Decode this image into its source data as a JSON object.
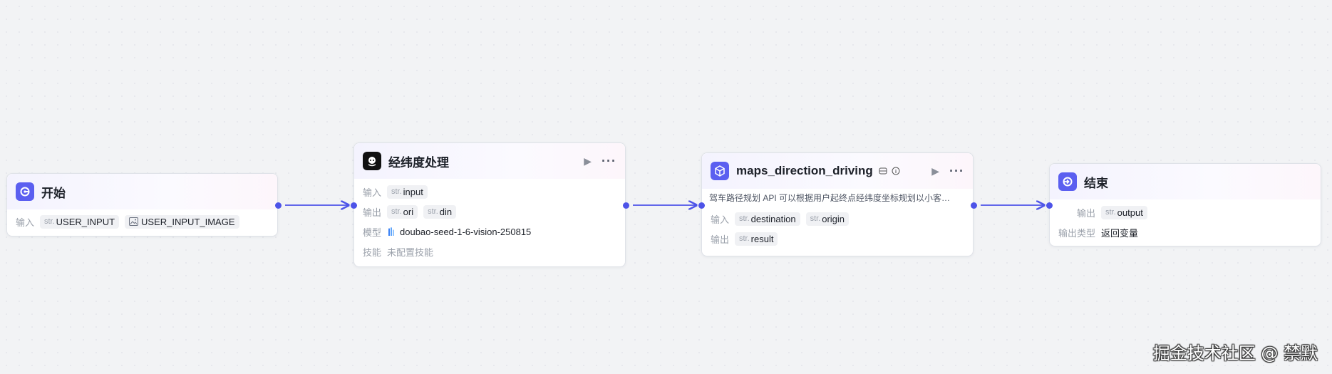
{
  "canvas": {
    "colors": {
      "accent": "#4d53e8",
      "background": "#f2f3f5"
    }
  },
  "nodes": {
    "start": {
      "title": "开始",
      "icon": "start-node-icon",
      "input_label": "输入",
      "inputs": [
        {
          "type": "str.",
          "name": "USER_INPUT"
        },
        {
          "type": "image-icon",
          "name": "USER_INPUT_IMAGE"
        }
      ]
    },
    "llm": {
      "title": "经纬度处理",
      "icon": "llm-node-icon",
      "input_label": "输入",
      "inputs": [
        {
          "type": "str.",
          "name": "input"
        }
      ],
      "output_label": "输出",
      "outputs": [
        {
          "type": "str.",
          "name": "ori"
        },
        {
          "type": "str.",
          "name": "din"
        }
      ],
      "model_label": "模型",
      "model": "doubao-seed-1-6-vision-250815",
      "skill_label": "技能",
      "skill": "未配置技能"
    },
    "plugin": {
      "title": "maps_direction_driving",
      "icon": "plugin-cube-icon",
      "description": "驾车路径规划 API 可以根据用户起终点经纬度坐标规划以小客…",
      "input_label": "输入",
      "inputs": [
        {
          "type": "str.",
          "name": "destination"
        },
        {
          "type": "str.",
          "name": "origin"
        }
      ],
      "output_label": "输出",
      "outputs": [
        {
          "type": "str.",
          "name": "result"
        }
      ]
    },
    "end": {
      "title": "结束",
      "icon": "end-node-icon",
      "output_label": "输出",
      "outputs": [
        {
          "type": "str.",
          "name": "output"
        }
      ],
      "output_type_label": "输出类型",
      "output_type": "返回变量"
    }
  },
  "watermark": "掘金技术社区 @ 禁默"
}
